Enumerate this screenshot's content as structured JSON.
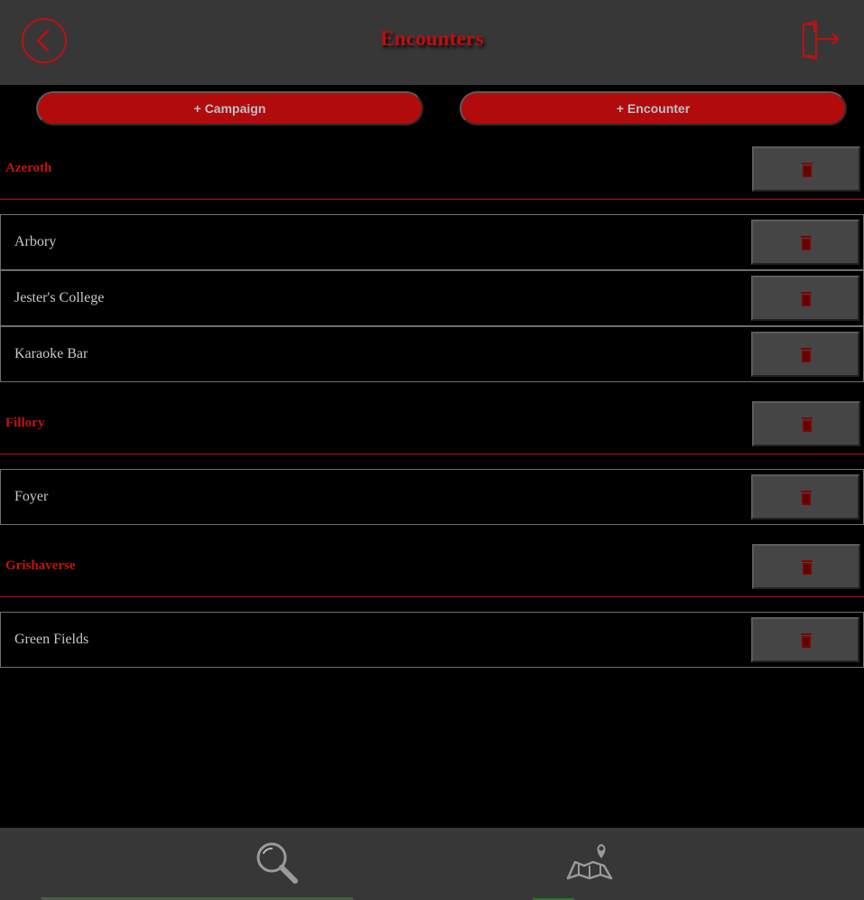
{
  "header": {
    "title": "Encounters",
    "back_icon": "chevron-left-circle-icon",
    "logout_icon": "logout-door-icon"
  },
  "actions": {
    "add_campaign_label": "+ Campaign",
    "add_encounter_label": "+ Encounter"
  },
  "campaigns": [
    {
      "name": "Azeroth",
      "encounters": [
        "Arbory",
        "Jester's College",
        "Karaoke Bar"
      ]
    },
    {
      "name": "Fillory",
      "encounters": [
        "Foyer"
      ]
    },
    {
      "name": "Grishaverse",
      "encounters": [
        "Green Fields"
      ]
    }
  ],
  "bottom_nav": {
    "items": [
      {
        "icon": "search-icon"
      },
      {
        "icon": "map-location-icon"
      }
    ]
  },
  "colors": {
    "accent": "#c00d0d",
    "header_bg": "#373737",
    "button_bg": "#b20b0b",
    "delete_bg": "#454545",
    "page_bg": "#000000"
  }
}
